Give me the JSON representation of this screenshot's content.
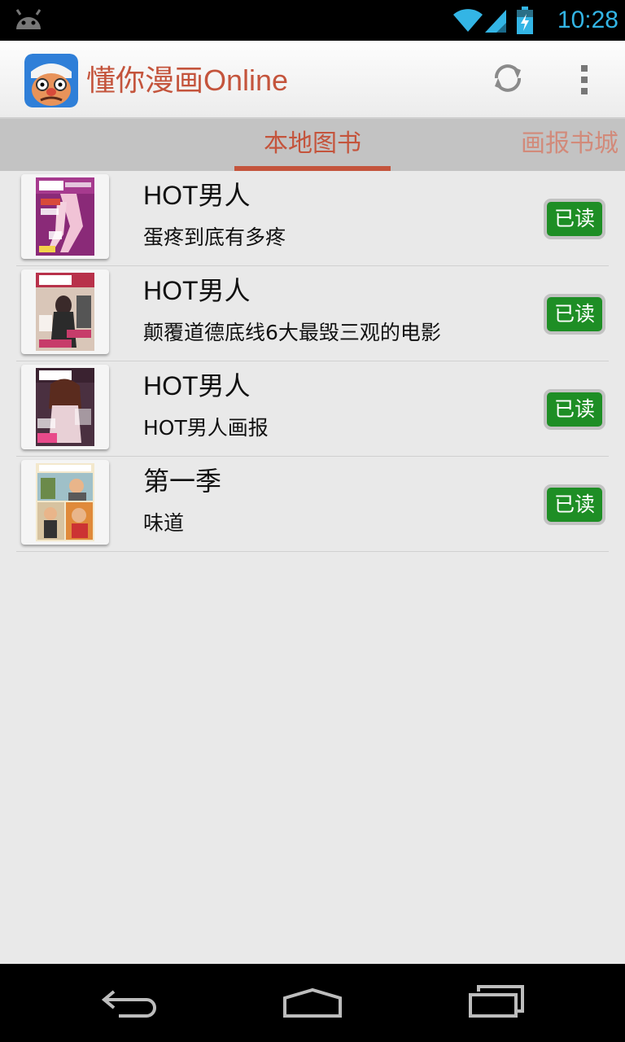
{
  "status_bar": {
    "time": "10:28",
    "icons": [
      "android-icon",
      "wifi-icon",
      "signal-icon",
      "battery-charging-icon"
    ],
    "accent": "#33b5e5"
  },
  "action_bar": {
    "title": "懂你漫画Online",
    "icons": [
      "app-icon",
      "refresh-icon",
      "overflow-menu-icon"
    ],
    "title_color": "#c4543c"
  },
  "tabs": [
    {
      "label": "本地图书",
      "selected": true
    },
    {
      "label": "画报书城",
      "selected": false
    }
  ],
  "books": [
    {
      "title": "HOT男人",
      "subtitle": "蛋疼到底有多疼",
      "status": "已读"
    },
    {
      "title": "HOT男人",
      "subtitle": "颠覆道德底线6大最毁三观的电影",
      "status": "已读"
    },
    {
      "title": "HOT男人",
      "subtitle": "HOT男人画报",
      "status": "已读"
    },
    {
      "title": "第一季",
      "subtitle": "味道",
      "status": "已读"
    }
  ],
  "colors": {
    "read_button": "#1e8e25",
    "tab_indicator": "#c4543c"
  },
  "nav_bar": {
    "icons": [
      "back-icon",
      "home-icon",
      "recent-apps-icon"
    ]
  }
}
